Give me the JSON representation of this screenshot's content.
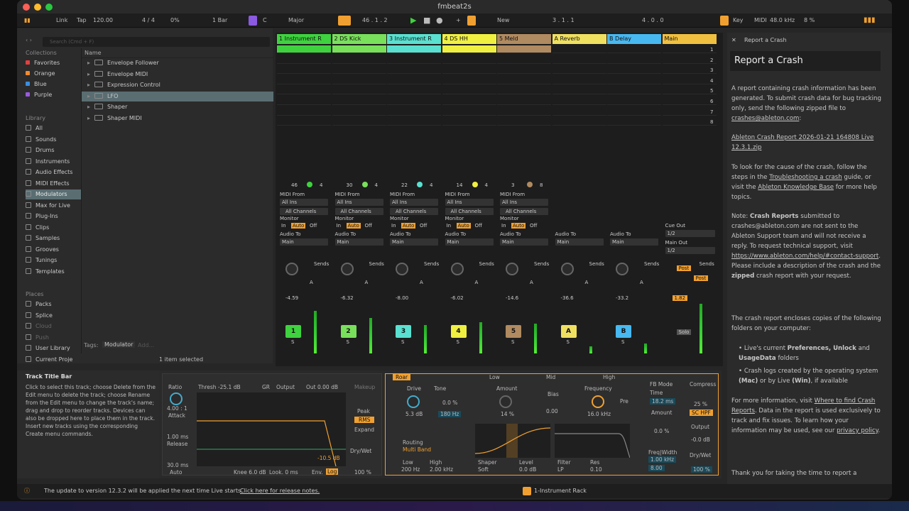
{
  "window": {
    "title": "fmbeat2s"
  },
  "toolbar": {
    "link": "Link",
    "tap": "Tap",
    "tempo": "120.00",
    "signature": "4 / 4",
    "swing": "0%",
    "quantize": "1 Bar",
    "key": "C",
    "scale": "Major",
    "position": "46 . 1 . 2",
    "new_label": "New",
    "loop_start": "3 . 1 . 1",
    "loop_len": "4 . 0 . 0",
    "key_label": "Key",
    "midi_label": "MIDI",
    "sample_rate": "48.0 kHz",
    "cpu": "8 %"
  },
  "browser": {
    "search_placeholder": "Search (Cmd + F)",
    "collections_title": "Collections",
    "collections": [
      {
        "label": "Favorites",
        "color": "#e04040"
      },
      {
        "label": "Orange",
        "color": "#f08a30"
      },
      {
        "label": "Blue",
        "color": "#3a8ee0"
      },
      {
        "label": "Purple",
        "color": "#9a5ae0"
      }
    ],
    "library_title": "Library",
    "library": [
      "All",
      "Sounds",
      "Drums",
      "Instruments",
      "Audio Effects",
      "MIDI Effects",
      "Modulators",
      "Max for Live",
      "Plug-Ins",
      "Clips",
      "Samples",
      "Grooves",
      "Tunings",
      "Templates"
    ],
    "places_title": "Places",
    "places": [
      "Packs",
      "Splice",
      "Cloud",
      "Push",
      "User Library",
      "Current Proje"
    ],
    "name_header": "Name",
    "items": [
      "Envelope Follower",
      "Envelope MIDI",
      "Expression Control",
      "LFO",
      "Shaper",
      "Shaper MIDI"
    ],
    "tags_label": "Tags:",
    "tag_value": "Modulator",
    "tag_add": "Add...",
    "selected_count": "1 item selected"
  },
  "tracks": [
    {
      "name": "1 Instrument R",
      "color": "#3fd23f",
      "num": "1",
      "vol": "-4.59",
      "clipstop": "46",
      "clipcount": "4"
    },
    {
      "name": "2 DS Kick",
      "color": "#78e05a",
      "num": "2",
      "vol": "-6.32",
      "clipstop": "30",
      "clipcount": "4"
    },
    {
      "name": "3 Instrument R",
      "color": "#5ae0d0",
      "num": "3",
      "vol": "-8.00",
      "clipstop": "22",
      "clipcount": "4"
    },
    {
      "name": "4 DS HH",
      "color": "#f0f040",
      "num": "4",
      "vol": "-6.02",
      "clipstop": "14",
      "clipcount": "4"
    },
    {
      "name": "5 Meld",
      "color": "#b08a60",
      "num": "5",
      "vol": "-14.6",
      "clipstop": "3",
      "clipcount": "8"
    },
    {
      "name": "A Reverb",
      "color": "#f0e060",
      "num": "A",
      "vol": "-36.6"
    },
    {
      "name": "B Delay",
      "color": "#48b8f0",
      "num": "B",
      "vol": "-33.2"
    },
    {
      "name": "Main",
      "color": "#f0c040",
      "vol": "1.82"
    }
  ],
  "scenes": [
    "1",
    "2",
    "3",
    "4",
    "5",
    "6",
    "7",
    "8"
  ],
  "mixer": {
    "midi_from": "MIDI From",
    "all_ins": "All Ins",
    "all_channels": "All Channels",
    "monitor": "Monitor",
    "in": "In",
    "auto": "Auto",
    "off": "Off",
    "audio_to": "Audio To",
    "main": "Main",
    "sends": "Sends",
    "cue_out": "Cue Out",
    "cue_val": "1/2",
    "main_out": "Main Out",
    "main_val": "1/2",
    "post": "Post",
    "solo": "Solo",
    "s": "S"
  },
  "help": {
    "title": "Track Title Bar",
    "body": "Click to select this track; choose Delete from the Edit menu to delete the track; choose Rename from the Edit menu to change the track's name; drag and drop to reorder tracks. Devices can also be dropped here to place them in the track. Insert new tracks using the corresponding Create menu commands."
  },
  "compressor": {
    "ratio_label": "Ratio",
    "ratio": "4.00 : 1",
    "attack_label": "Attack",
    "attack": "1.00 ms",
    "release_label": "Release",
    "release": "30.0 ms",
    "auto": "Auto",
    "thresh": "Thresh -25.1 dB",
    "gr": "GR",
    "output": "Output",
    "out": "Out 0.00 dB",
    "makeup": "Makeup",
    "peak": "Peak",
    "rms": "RMS",
    "expand": "Expand",
    "knee": "Knee 6.0 dB",
    "look": "Look. 0 ms",
    "env": "Env.",
    "log": "Log",
    "db_marker": "-10.5 dB",
    "drywet": "Dry/Wet",
    "drywet_val": "100 %"
  },
  "roar": {
    "name": "Roar",
    "low": "Low",
    "mid": "Mid",
    "high": "High",
    "drive": "Drive",
    "drive_val": "5.3 dB",
    "tone": "Tone",
    "tone_val": "0.0 %",
    "tone_freq": "180 Hz",
    "routing": "Routing",
    "routing_val": "Multi Band",
    "low_freq": "200 Hz",
    "high_freq": "2.00 kHz",
    "amount": "Amount",
    "amount_val": "14 %",
    "bias": "Bias",
    "bias_val": "0.00",
    "frequency": "Frequency",
    "freq_val": "16.0 kHz",
    "pre": "Pre",
    "shaper": "Shaper",
    "soft": "Soft",
    "level": "Level",
    "level_val": "0.0 dB",
    "filter": "Filter",
    "lp": "LP",
    "res": "Res",
    "res_val": "0.10",
    "fb_mode": "FB Mode",
    "time": "Time",
    "time_val": "18.2 ms",
    "fb_amount": "Amount",
    "fb_amount_val": "0.0 %",
    "freq_width": "Freq|Width",
    "fw_val": "1.00 kHz",
    "fw_val2": "8.00",
    "compress": "Compress",
    "compress_val": "25 %",
    "sc_hpf": "SC HPF",
    "output": "Output",
    "output_val": "-0.0 dB",
    "drywet": "Dry/Wet",
    "drywet_val": "100 %",
    "sidechain": "Sidechain",
    "midi_in": "MIDI In",
    "modulation": "Modulation"
  },
  "status": {
    "update": "The update to version 12.3.2 will be applied the next time Live starts.",
    "release_notes": "Click here for release notes.",
    "track_name": "1-Instrument Rack"
  },
  "crash": {
    "title": "Report a Crash",
    "header": "Report a Crash",
    "p1": "A report containing crash information has been generated. To submit crash data for bug tracking only, send the following zipped file to",
    "email": "crashes@ableton.com",
    "p1_end": ":",
    "file": "Ableton Crash Report 2026-01-21 164808 Live 12.3.1.zip",
    "p2a": "To look for the cause of the crash, follow the steps in the",
    "p2_link": "Troubleshooting a crash",
    "p2b": "guide, or visit the",
    "p2_link2": "Ableton Knowledge Base",
    "p2c": "for more help topics.",
    "p3a": "Note:",
    "p3b": "Crash Reports",
    "p3c": "submitted to crashes@ableton.com are not sent to the Ableton Support team and will not receive a reply. To request technical support, visit",
    "p3_link": "https://www.ableton.com/help/#contact-support",
    "p3d": ". Please include a description of the crash and the",
    "p3e": "zipped",
    "p3f": "crash report with your request.",
    "p4": "The crash report encloses copies of the following folders on your computer:",
    "b1a": "Live's current",
    "b1b": "Preferences, Unlock",
    "b1c": "and",
    "b1d": "UsageData",
    "b1e": "folders",
    "b2a": "Crash logs created by the operating system",
    "b2b": "(Mac)",
    "b2c": "or by Live",
    "b2d": "(Win)",
    "b2e": ", if available",
    "p5a": "For more information, visit",
    "p5_link": "Where to find Crash Reports",
    "p5b": ". Data in the report is used exclusively to track and fix issues. To learn how your information may be used, see our",
    "p5_link2": "privacy policy",
    "p5c": ".",
    "p6": "Thank you for taking the time to report a"
  }
}
